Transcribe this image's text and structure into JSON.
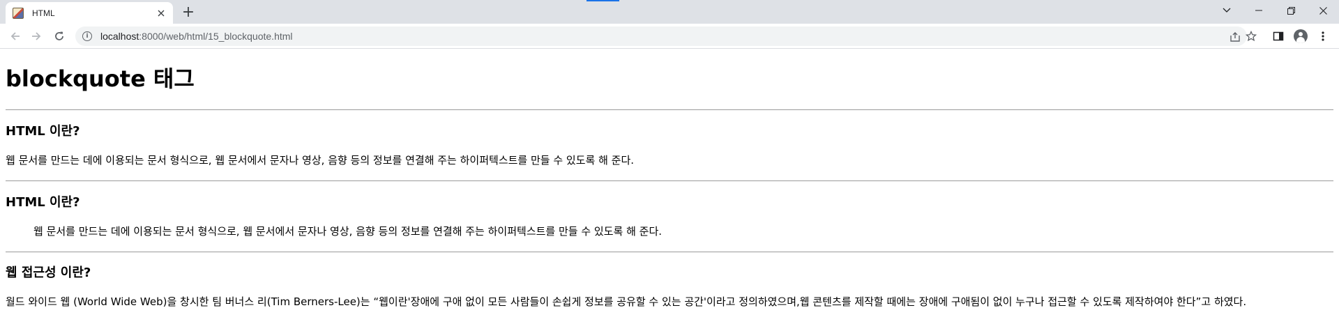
{
  "browser": {
    "tab_title": "HTML",
    "new_tab_symbol": "+",
    "url_host": "localhost",
    "url_path": ":8000/web/html/15_blockquote.html"
  },
  "page": {
    "title": "blockquote 태그",
    "sections": [
      {
        "heading": "HTML 이란?",
        "text": "웹 문서를 만드는 데에 이용되는 문서 형식으로, 웹 문서에서 문자나 영상, 음향 등의 정보를 연결해 주는 하이퍼텍스트를 만들 수 있도록 해 준다."
      },
      {
        "heading": "HTML 이란?",
        "quote": "웹 문서를 만드는 데에 이용되는 문서 형식으로, 웹 문서에서 문자나 영상, 음향 등의 정보를 연결해 주는 하이퍼텍스트를 만들 수 있도록 해 준다."
      },
      {
        "heading": "웹 접근성 이란?",
        "text": "월드 와이드 웹 (World Wide Web)을 창시한 팀 버너스 리(Tim Berners-Lee)는 “웹이란'장애에 구애 없이 모든 사람들이 손쉽게 정보를 공유할 수 있는 공간'이라고 정의하였으며,웹 콘텐츠를 제작할 때에는 장애에 구애됨이 없이 누구나 접근할 수 있도록 제작하여야 한다”고 하였다."
      }
    ]
  }
}
